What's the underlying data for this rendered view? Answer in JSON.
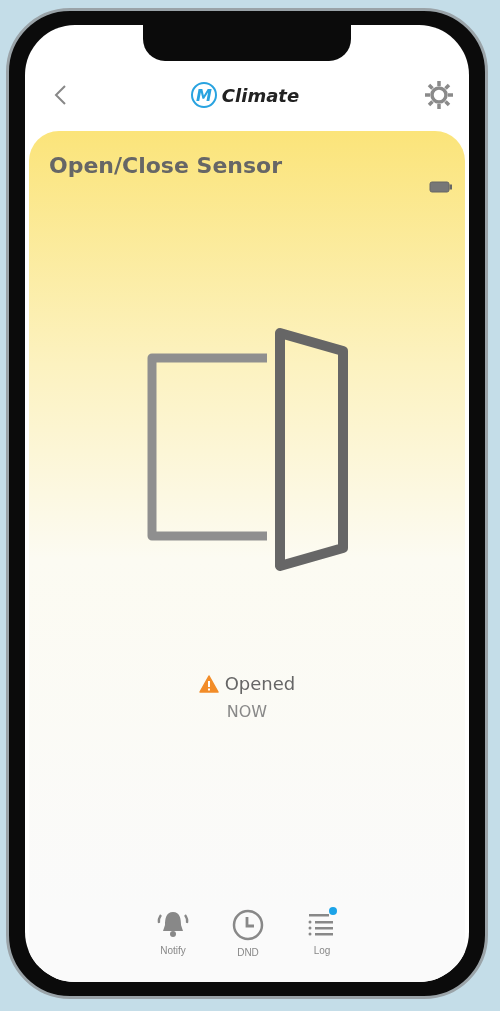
{
  "header": {
    "app_name": "Climate",
    "logo_letter": "M"
  },
  "card": {
    "title": "Open/Close Sensor",
    "status": {
      "label": "Opened",
      "alert": true,
      "time": "NOW"
    }
  },
  "nav": [
    {
      "kind": "bell",
      "label": "Notify",
      "badge": false
    },
    {
      "kind": "clock",
      "label": "DND",
      "badge": false
    },
    {
      "kind": "list",
      "label": "Log",
      "badge": true
    }
  ]
}
